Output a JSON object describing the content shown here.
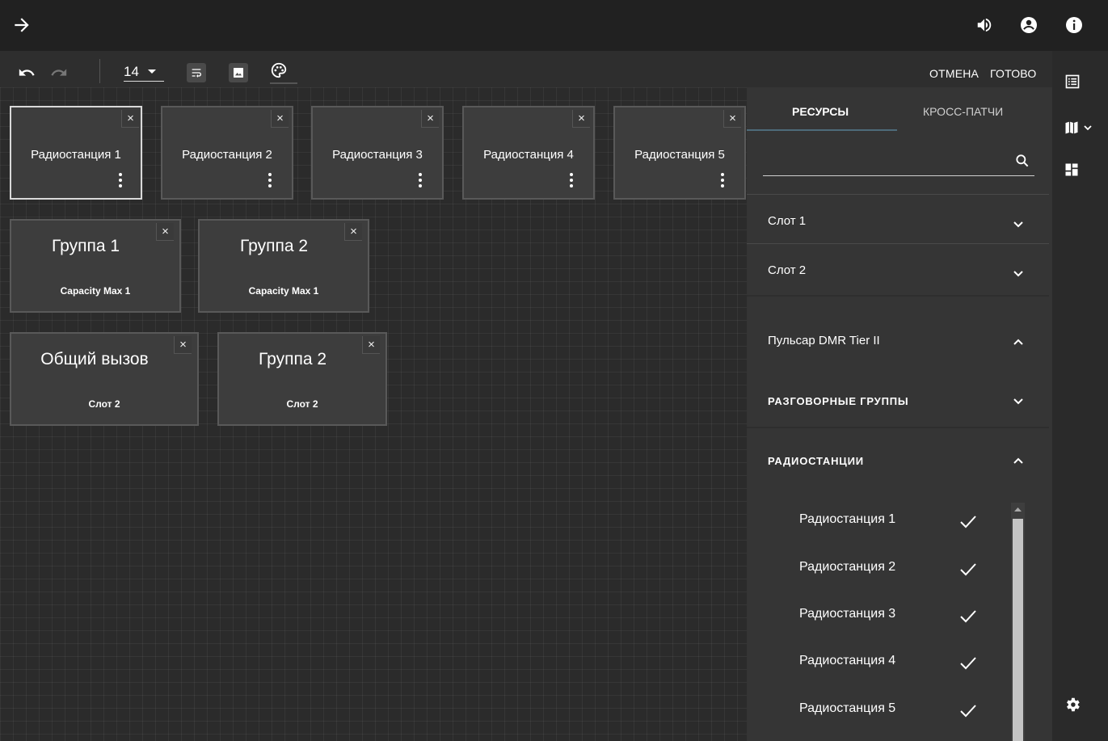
{
  "topbar": {
    "back_icon": "arrow-right-icon",
    "icons": [
      "volume-icon",
      "account-icon",
      "info-icon"
    ]
  },
  "toolbar": {
    "font_size": "14",
    "cancel_label": "ОТМЕНА",
    "done_label": "ГОТОВО"
  },
  "canvas": {
    "radios": [
      {
        "label": "Радиостанция 1",
        "selected": true
      },
      {
        "label": "Радиостанция 2",
        "selected": false
      },
      {
        "label": "Радиостанция 3",
        "selected": false
      },
      {
        "label": "Радиостанция 4",
        "selected": false
      },
      {
        "label": "Радиостанция 5",
        "selected": false
      }
    ],
    "groups_row1": [
      {
        "title": "Группа 1",
        "sub": "Capacity Max 1"
      },
      {
        "title": "Группа 2",
        "sub": "Capacity Max 1"
      }
    ],
    "groups_row2": [
      {
        "title": "Общий вызов",
        "sub": "Слот 2"
      },
      {
        "title": "Группа 2",
        "sub": "Слот 2"
      }
    ],
    "close_glyph": "×"
  },
  "panel": {
    "tabs": [
      "РЕСУРСЫ",
      "КРОСС-ПАТЧИ"
    ],
    "search_placeholder": "",
    "slot1": "Слот 1",
    "slot2": "Слот 2",
    "system": "Пульсар DMR Tier II",
    "talkgroups": "РАЗГОВОРНЫЕ ГРУППЫ",
    "radios_header": "РАДИОСТАНЦИИ",
    "radio_items": [
      "Радиостанция 1",
      "Радиостанция 2",
      "Радиостанция 3",
      "Радиостанция 4",
      "Радиостанция 5"
    ]
  },
  "colors": {
    "bg": "#2b2b2b",
    "panel": "#353535",
    "topbar": "#212121",
    "tile": "#3d3d3d"
  }
}
